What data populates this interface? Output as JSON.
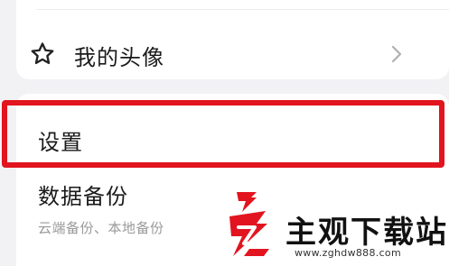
{
  "menu": {
    "avatar_item": {
      "label": "我的头像",
      "icon": "star-outline-icon"
    }
  },
  "settings": {
    "title": "设置",
    "highlight_color": "#e2141f"
  },
  "backup": {
    "title": "数据备份",
    "subtitle": "云端备份、本地备份"
  },
  "watermark": {
    "text": "主观下载站",
    "url": "www.zghdw888.com"
  }
}
